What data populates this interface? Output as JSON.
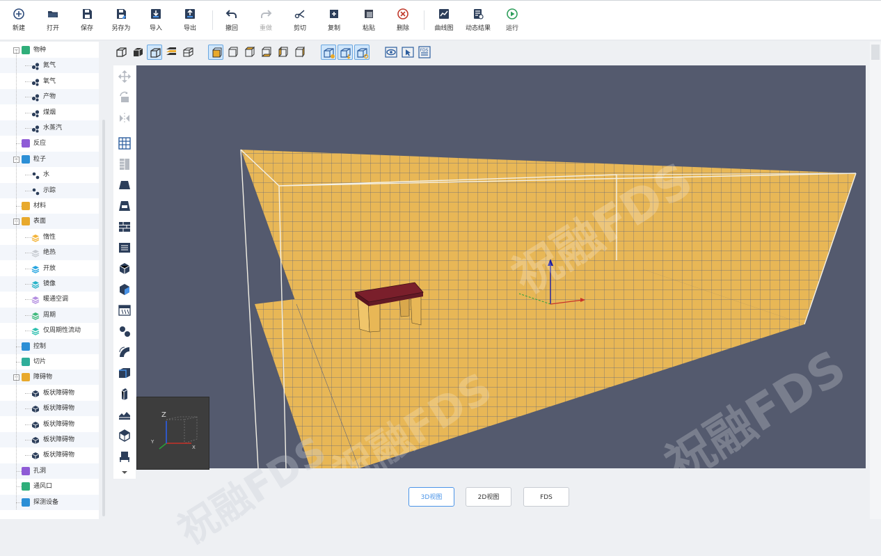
{
  "toolbar": {
    "items": [
      {
        "label": "新建",
        "icon": "plus-circle-icon"
      },
      {
        "label": "打开",
        "icon": "folder-open-icon"
      },
      {
        "label": "保存",
        "icon": "save-icon"
      },
      {
        "label": "另存为",
        "icon": "save-as-icon"
      },
      {
        "label": "导入",
        "icon": "import-icon"
      },
      {
        "label": "导出",
        "icon": "export-icon"
      },
      {
        "label": "撤回",
        "icon": "undo-icon"
      },
      {
        "label": "重做",
        "icon": "redo-icon"
      },
      {
        "label": "剪切",
        "icon": "scissors-icon"
      },
      {
        "label": "复制",
        "icon": "copy-icon"
      },
      {
        "label": "粘贴",
        "icon": "paste-icon"
      },
      {
        "label": "删除",
        "icon": "delete-circle-icon"
      },
      {
        "label": "曲线图",
        "icon": "line-chart-icon"
      },
      {
        "label": "动态结果",
        "icon": "result-document-icon"
      },
      {
        "label": "运行",
        "icon": "play-circle-icon"
      }
    ]
  },
  "tree": {
    "items": [
      {
        "label": "物种",
        "icon": "species-icon",
        "level": 0,
        "toggle": "−"
      },
      {
        "label": "氮气",
        "icon": "molecule-icon",
        "level": 1
      },
      {
        "label": "氧气",
        "icon": "molecule-icon",
        "level": 1
      },
      {
        "label": "产物",
        "icon": "molecule-icon",
        "level": 1
      },
      {
        "label": "煤烟",
        "icon": "molecule-icon",
        "level": 1
      },
      {
        "label": "水蒸汽",
        "icon": "molecule-icon",
        "level": 1
      },
      {
        "label": "反应",
        "icon": "reaction-icon",
        "level": 0
      },
      {
        "label": "粒子",
        "icon": "particle-icon",
        "level": 0,
        "toggle": "−"
      },
      {
        "label": "水",
        "icon": "particle-dot-icon",
        "level": 1
      },
      {
        "label": "示踪",
        "icon": "particle-dot-icon",
        "level": 1
      },
      {
        "label": "材料",
        "icon": "material-icon",
        "level": 0
      },
      {
        "label": "表面",
        "icon": "surface-icon",
        "level": 0,
        "toggle": "−"
      },
      {
        "label": "惰性",
        "icon": "layers-icon",
        "level": 1
      },
      {
        "label": "绝热",
        "icon": "layers-icon",
        "level": 1
      },
      {
        "label": "开放",
        "icon": "layers-icon",
        "level": 1
      },
      {
        "label": "镜像",
        "icon": "layers-icon",
        "level": 1
      },
      {
        "label": "暖通空调",
        "icon": "layers-icon",
        "level": 1
      },
      {
        "label": "周期",
        "icon": "layers-icon",
        "level": 1
      },
      {
        "label": "仅周期性流动",
        "icon": "layers-icon",
        "level": 1
      },
      {
        "label": "控制",
        "icon": "control-icon",
        "level": 0
      },
      {
        "label": "切片",
        "icon": "slice-icon",
        "level": 0
      },
      {
        "label": "障碍物",
        "icon": "obstruction-icon",
        "level": 0,
        "toggle": "−"
      },
      {
        "label": "板状障碍物",
        "icon": "cube-icon",
        "level": 1
      },
      {
        "label": "板状障碍物",
        "icon": "cube-icon",
        "level": 1
      },
      {
        "label": "板状障碍物",
        "icon": "cube-icon",
        "level": 1
      },
      {
        "label": "板状障碍物",
        "icon": "cube-icon",
        "level": 1
      },
      {
        "label": "板状障碍物",
        "icon": "cube-icon",
        "level": 1
      },
      {
        "label": "孔洞",
        "icon": "hole-icon",
        "level": 0
      },
      {
        "label": "通风口",
        "icon": "vent-icon",
        "level": 0
      },
      {
        "label": "探测设备",
        "icon": "device-icon",
        "level": 0
      }
    ]
  },
  "axes": {
    "x": "X",
    "y": "Y",
    "z": "Z"
  },
  "tabs": [
    {
      "label": "3D视图",
      "active": true
    },
    {
      "label": "2D视图",
      "active": false
    },
    {
      "label": "FDS",
      "active": false
    }
  ],
  "watermark": "祝融FDS",
  "colors": {
    "accent": "#4a94e8",
    "floor": "#e8b756",
    "table_top": "#7a1f2b",
    "viewport_bg": "#545a6e"
  }
}
